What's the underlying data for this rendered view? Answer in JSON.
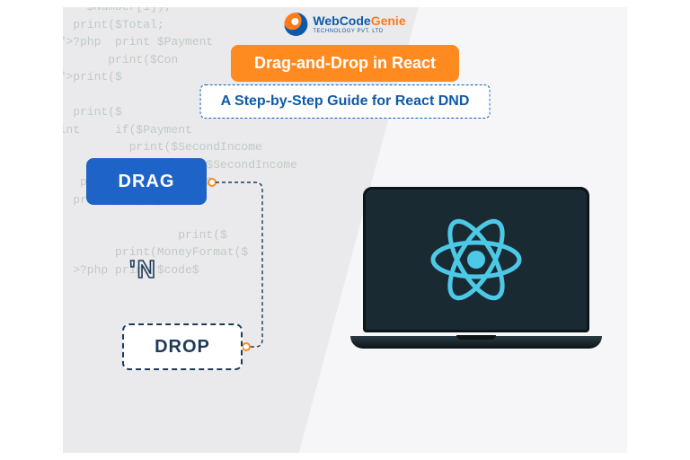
{
  "logo": {
    "brand_part1": "WebCode",
    "brand_part2": "Genie",
    "tagline": "TECHNOLOGY PVT. LTD"
  },
  "header": {
    "title": "Drag-and-Drop in React",
    "subtitle": "A Step-by-Step Guide for React DND"
  },
  "diagram": {
    "drag_label": "DRAG",
    "n_label": "'N",
    "drop_label": "DROP"
  },
  "colors": {
    "accent_orange": "#ff8a1f",
    "accent_blue": "#1e63c7",
    "dashed_navy": "#1e3a5a",
    "logo_navy": "#0e5aa8",
    "react_cyan": "#4cc9e6",
    "laptop_screen": "#1a2a33"
  },
  "code_background": "      $Number[1]);\n    print($Total;\n\"2\">?php  print $Payment\n         print($Con\n\"2\">print($\n\n    print($\nprint     if($Payment\n            print($SecondIncome\n                 print($SecondIncome\n     print MoneyFormat($\n    print($  ); print:\n\n                   print($\n          print(MoneyFormat($\n    >?php print $code$"
}
